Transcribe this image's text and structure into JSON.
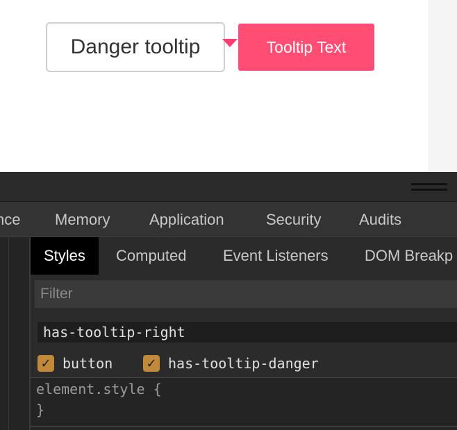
{
  "preview": {
    "button_label": "Danger tooltip",
    "tooltip_text": "Tooltip Text",
    "tooltip_color": "#ff4d74"
  },
  "devtools": {
    "main_tabs": [
      {
        "label": "nce"
      },
      {
        "label": "Memory"
      },
      {
        "label": "Application"
      },
      {
        "label": "Security"
      },
      {
        "label": "Audits"
      }
    ],
    "sub_tabs": [
      {
        "label": "Styles",
        "active": true
      },
      {
        "label": "Computed"
      },
      {
        "label": "Event Listeners"
      },
      {
        "label": "DOM Breakp"
      }
    ],
    "filter": {
      "placeholder": "Filter",
      "value": ""
    },
    "class_input": {
      "value": "has-tooltip-right"
    },
    "classes": [
      {
        "label": "button",
        "checked": true
      },
      {
        "label": "has-tooltip-danger",
        "checked": true
      }
    ],
    "style_rule": {
      "selector_line": "element.style {",
      "close_line": "}"
    },
    "checkbox_color": "#c08a3a"
  }
}
